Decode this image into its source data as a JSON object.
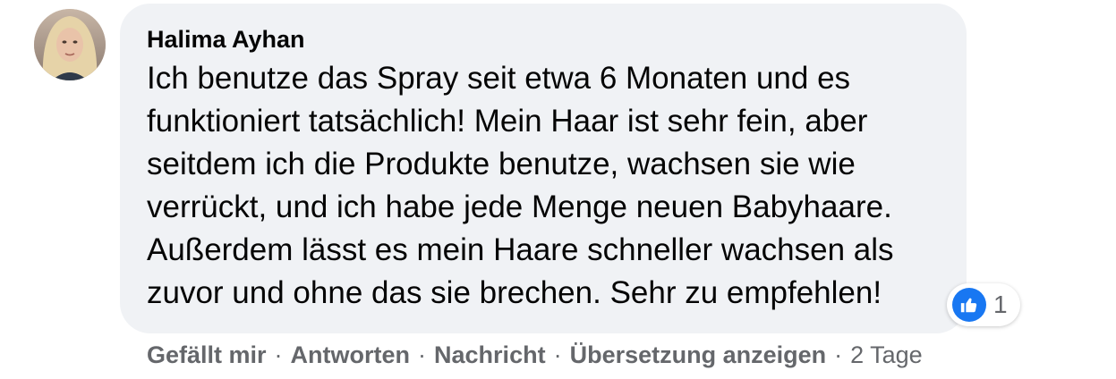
{
  "comment": {
    "author": "Halima Ayhan",
    "text": "Ich benutze das Spray seit etwa 6 Monaten und es\nfunktioniert tatsächlich! Mein Haar ist sehr fein, aber\nseitdem ich die Produkte benutze, wachsen sie wie\nverrückt, und ich habe jede Menge neuen Babyhaare.\nAußerdem lässt es mein Haare schneller wachsen als\nzuvor und ohne das sie brechen. Sehr zu empfehlen!",
    "reaction": {
      "icon": "like-icon",
      "count": "1"
    }
  },
  "actions": {
    "like_label": "Gefällt mir",
    "reply_label": "Antworten",
    "message_label": "Nachricht",
    "translate_label": "Übersetzung anzeigen",
    "separator": "·",
    "timestamp": "2 Tage"
  },
  "colors": {
    "bubble": "#f0f2f5",
    "text": "#050505",
    "muted": "#65676b",
    "like_blue": "#1877f2"
  }
}
